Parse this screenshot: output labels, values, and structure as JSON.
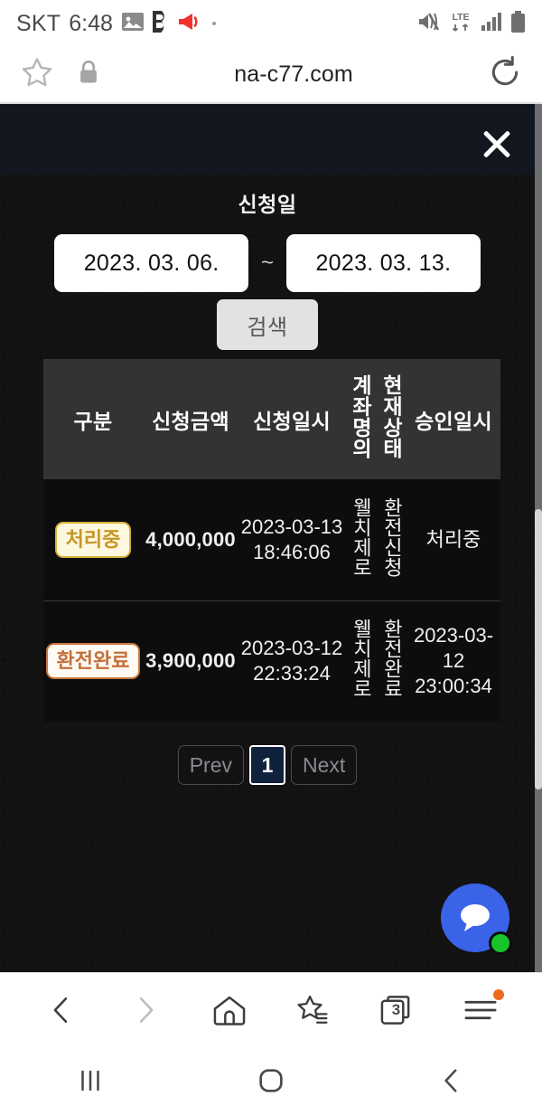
{
  "status_bar": {
    "carrier": "SKT",
    "time": "6:48",
    "network": "LTE",
    "icons": [
      "image-icon",
      "b-app-icon",
      "megaphone-icon",
      "dot-icon",
      "mute-icon",
      "lte-icon",
      "signal-bars-icon",
      "battery-icon"
    ]
  },
  "browser": {
    "url": "na-c77.com",
    "icons": [
      "star-outline-icon",
      "lock-icon",
      "reload-icon"
    ],
    "toolbar": {
      "back": "back-icon",
      "forward": "forward-icon",
      "home": "home-icon",
      "bookmarks": "bookmark-star-icon",
      "tabs_count": "3",
      "menu": "menu-icon"
    }
  },
  "modal": {
    "close_label": "close-icon",
    "date_filter": {
      "label": "신청일",
      "start_date": "2023. 03. 06.",
      "end_date": "2023. 03. 13.",
      "separator": "~",
      "search_label": "검색"
    }
  },
  "table": {
    "headers": [
      "구분",
      "신청금액",
      "신청일시",
      "계좌명의",
      "현재상태",
      "승인일시"
    ],
    "rows": [
      {
        "status_badge": "처리중",
        "badge_type": "processing",
        "amount": "4,000,000",
        "request_date": "2023-03-13",
        "request_time": "18:46:06",
        "account_name": "웰치제로",
        "current_state": "환전신청",
        "approve_date": "처리중",
        "approve_time": ""
      },
      {
        "status_badge": "환전완료",
        "badge_type": "done",
        "amount": "3,900,000",
        "request_date": "2023-03-12",
        "request_time": "22:33:24",
        "account_name": "웰치제로",
        "current_state": "환전완료",
        "approve_date": "2023-03-12",
        "approve_time": "23:00:34"
      }
    ]
  },
  "pagination": {
    "prev": "Prev",
    "current_page": "1",
    "next": "Next"
  },
  "chat": {
    "label": "chat-bubble-icon",
    "online": true
  },
  "android_nav": {
    "recents": "recents-icon",
    "home": "home-circle-icon",
    "back": "back-chevron-icon"
  },
  "colors": {
    "accent_amount": "#d4941e",
    "badge_processing_border": "#d9b13c",
    "badge_done_border": "#c9763a",
    "chat_fab": "#3a63e8",
    "online_dot": "#17c52a",
    "page_bg": "#121212",
    "table_header_bg": "#333333"
  }
}
